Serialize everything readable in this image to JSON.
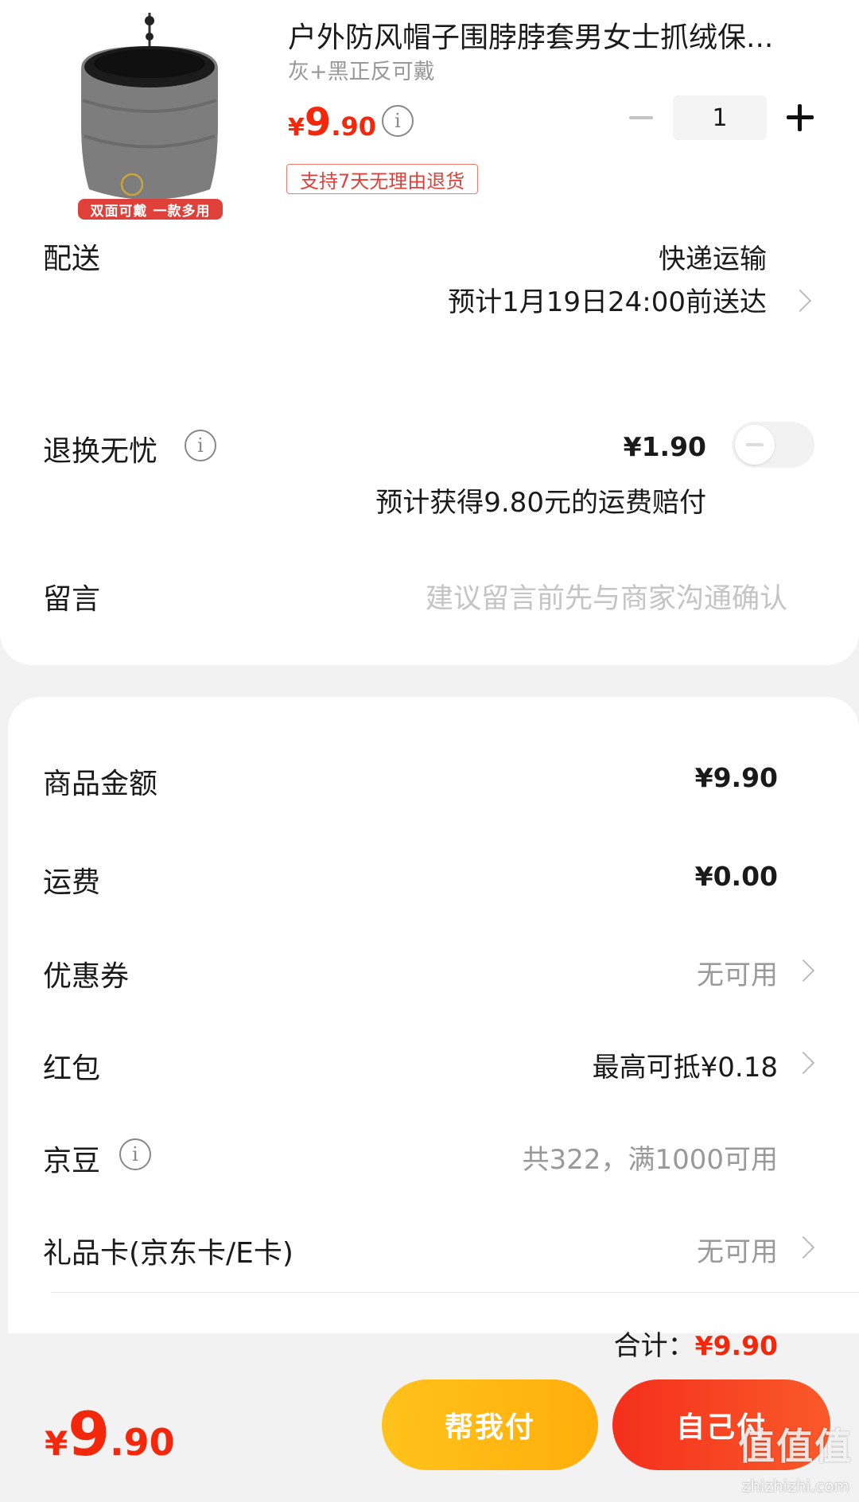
{
  "product": {
    "title": "户外防风帽子围脖脖套男女士抓绒保...",
    "spec": "灰+黑正反可戴",
    "price_currency": "¥",
    "price_int": "9",
    "price_dec": ".90",
    "tag": "支持7天无理由退货",
    "image_badge": "双面可戴 一款多用",
    "quantity": "1"
  },
  "delivery": {
    "label": "配送",
    "method": "快递运输",
    "eta": "预计1月19日24:00前送达"
  },
  "return_insurance": {
    "label": "退换无忧",
    "price": "¥1.90",
    "desc": "预计获得9.80元的运费赔付",
    "enabled": false
  },
  "message": {
    "label": "留言",
    "placeholder": "建议留言前先与商家沟通确认"
  },
  "summary": {
    "goods_label": "商品金额",
    "goods_value": "¥9.90",
    "shipping_label": "运费",
    "shipping_value": "¥0.00",
    "coupon_label": "优惠券",
    "coupon_value": "无可用",
    "redpacket_label": "红包",
    "redpacket_value": "最高可抵¥0.18",
    "beans_label": "京豆",
    "beans_value": "共322，满1000可用",
    "giftcard_label": "礼品卡(京东卡/E卡)",
    "giftcard_value": "无可用",
    "total_label": "合计：",
    "total_value": "¥9.90"
  },
  "bottom_bar": {
    "price_currency": "¥",
    "price_int": "9",
    "price_dec": ".90",
    "help_pay_label": "帮我付",
    "self_pay_label": "自己付"
  },
  "watermark": {
    "text": "值值值",
    "site": "zhizhizhi.com"
  },
  "colors": {
    "accent_red": "#f2270c",
    "help_pay": "#ffb813",
    "self_pay": "#f53a20"
  }
}
